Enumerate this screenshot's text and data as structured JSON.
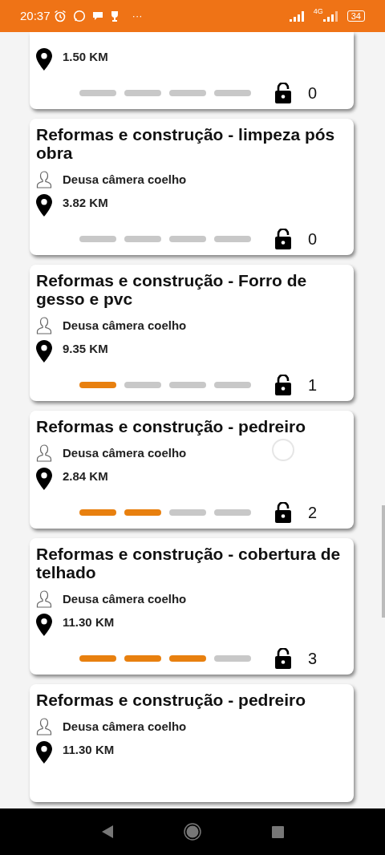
{
  "status_bar": {
    "time": "20:37",
    "more": "···",
    "network": "4G",
    "battery": "34"
  },
  "cards": [
    {
      "distance": "1.50 KM",
      "steps": [
        {
          "done": false
        },
        {
          "done": false
        },
        {
          "done": false
        },
        {
          "done": false
        }
      ],
      "count": "0"
    },
    {
      "title": "Reformas e construção - limpeza pós obra",
      "name": "Deusa câmera coelho",
      "distance": "3.82 KM",
      "steps": [
        {
          "done": false
        },
        {
          "done": false
        },
        {
          "done": false
        },
        {
          "done": false
        }
      ],
      "count": "0"
    },
    {
      "title": "Reformas e construção - Forro de gesso e pvc",
      "name": "Deusa câmera coelho",
      "distance": "9.35 KM",
      "steps": [
        {
          "done": true
        },
        {
          "done": false
        },
        {
          "done": false
        },
        {
          "done": false
        }
      ],
      "count": "1"
    },
    {
      "title": "Reformas e construção - pedreiro",
      "name": "Deusa câmera coelho",
      "distance": "2.84 KM",
      "steps": [
        {
          "done": true
        },
        {
          "done": true
        },
        {
          "done": false
        },
        {
          "done": false
        }
      ],
      "count": "2",
      "loading": true
    },
    {
      "title": "Reformas e construção - cobertura de telhado",
      "name": "Deusa câmera coelho",
      "distance": "11.30 KM",
      "steps": [
        {
          "done": true
        },
        {
          "done": true
        },
        {
          "done": true
        },
        {
          "done": false
        }
      ],
      "count": "3"
    },
    {
      "title": "Reformas e construção - pedreiro",
      "name": "Deusa câmera coelho",
      "distance": "11.30 KM"
    }
  ]
}
